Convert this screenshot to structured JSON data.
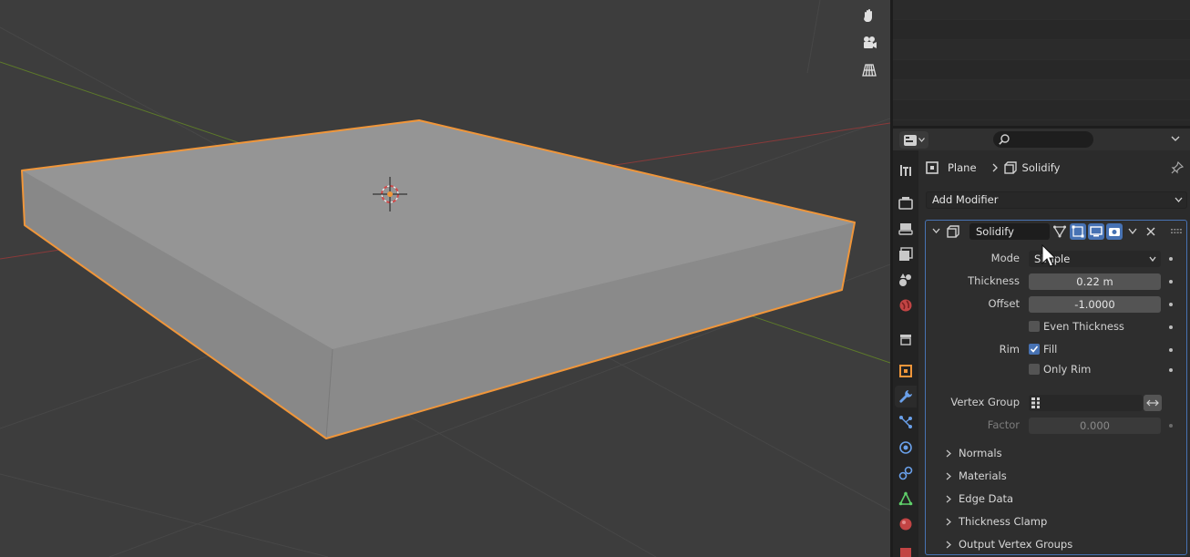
{
  "properties": {
    "breadcrumb": {
      "object": "Plane",
      "modifier": "Solidify"
    },
    "add_modifier_label": "Add Modifier",
    "modifier": {
      "name": "Solidify",
      "mode": {
        "label": "Mode",
        "value": "Simple"
      },
      "thickness": {
        "label": "Thickness",
        "value": "0.22 m"
      },
      "offset": {
        "label": "Offset",
        "value": "-1.0000"
      },
      "even_thickness": {
        "label": "Even Thickness",
        "checked": false
      },
      "rim": {
        "label": "Rim",
        "fill_label": "Fill",
        "fill_checked": true,
        "only_rim_label": "Only Rim",
        "only_rim_checked": false
      },
      "vertex_group": {
        "label": "Vertex Group",
        "value": ""
      },
      "factor": {
        "label": "Factor",
        "value": "0.000"
      },
      "subpanels": [
        "Normals",
        "Materials",
        "Edge Data",
        "Thickness Clamp",
        "Output Vertex Groups"
      ]
    }
  },
  "colors": {
    "accent": "#4772b3",
    "selection_outline": "#f0963a"
  },
  "icons": {
    "viewport_gizmos": [
      "hand-pan-icon",
      "camera-icon",
      "grid-perspective-icon"
    ],
    "tabs": [
      "tool-icon",
      "render-icon",
      "output-icon",
      "view-layer-icon",
      "scene-icon",
      "world-icon",
      "collection-icon",
      "object-icon",
      "modifier-wrench-icon",
      "particles-icon",
      "physics-icon",
      "constraints-icon",
      "object-data-icon",
      "material-icon",
      "texture-icon"
    ]
  }
}
